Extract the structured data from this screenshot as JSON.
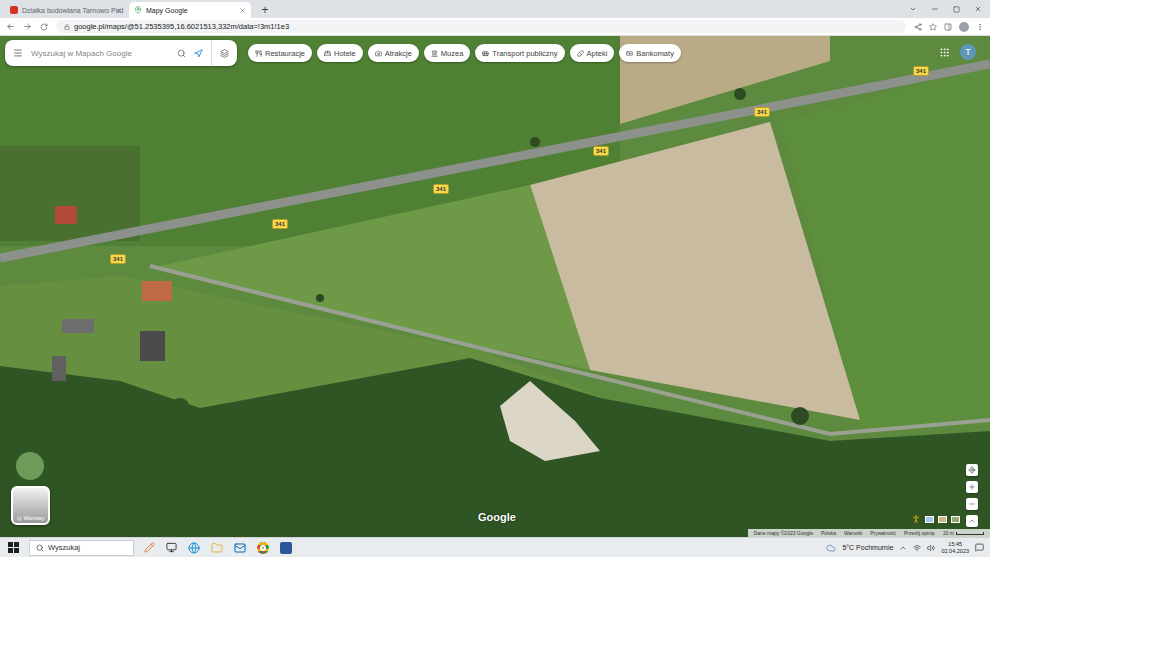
{
  "browser": {
    "tabs": [
      {
        "label": "Działka budowlana Tarnowo Pod",
        "selected": false
      },
      {
        "label": "Mapy Google",
        "selected": true
      }
    ],
    "new_tab": "+",
    "address": "google.pl/maps/@51.2535395,16.6021513,332m/data=!3m1!1e3"
  },
  "map": {
    "search": {
      "placeholder": "Wyszukaj w Mapach Google"
    },
    "chips": [
      "Restauracje",
      "Hotele",
      "Atrakcje",
      "Muzea",
      "Transport publiczny",
      "Apteki",
      "Bankomaty"
    ],
    "account": "T",
    "road_labels": [
      "341",
      "341",
      "341",
      "341",
      "341",
      "341"
    ],
    "layers": "Warstwy",
    "logo": "Google",
    "footer": [
      "Dane mapy ©2023 Google",
      "Polska",
      "Warunki",
      "Prywatność",
      "Prześlij opinię"
    ],
    "scale": "20 m"
  },
  "taskbar": {
    "search": "Wyszukaj",
    "weather": "5°C Pochmurnie",
    "time": "15:45",
    "date": "02.04.2023"
  }
}
